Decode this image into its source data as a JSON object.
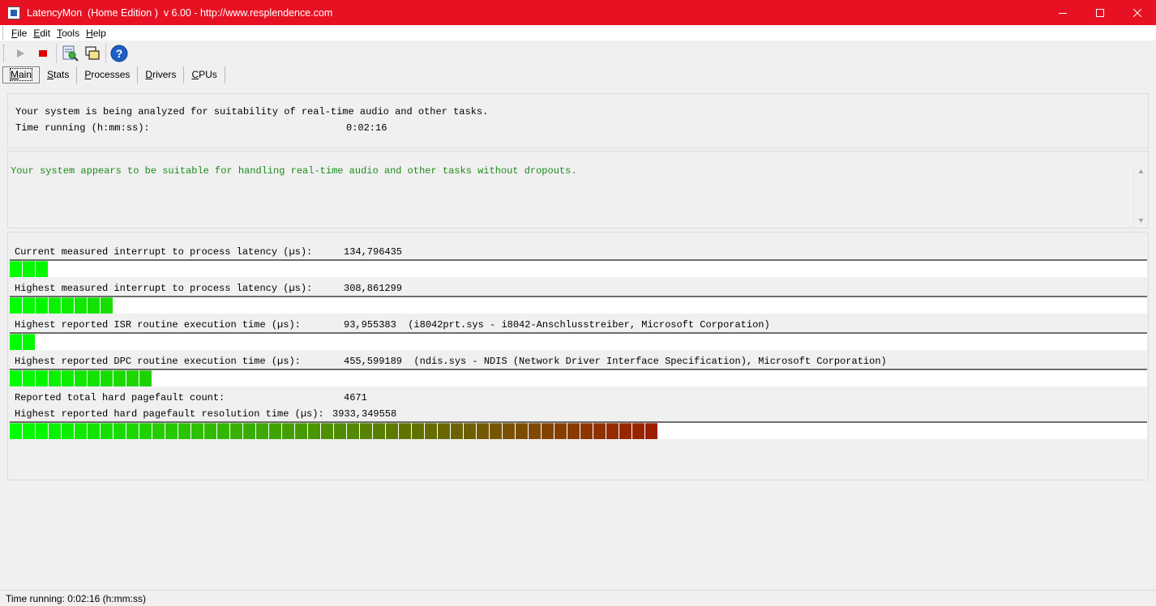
{
  "window": {
    "title": "LatencyMon  (Home Edition )  v 6.00 - http://www.resplendence.com",
    "accent_color": "#e81123"
  },
  "menu": [
    "File",
    "Edit",
    "Tools",
    "Help"
  ],
  "toolbar": {
    "icons": [
      "play-icon",
      "stop-icon",
      "report-icon",
      "windows-icon",
      "help-icon"
    ]
  },
  "tabs": [
    "Main",
    "Stats",
    "Processes",
    "Drivers",
    "CPUs"
  ],
  "summary": {
    "analyzing_text": "Your system is being analyzed for suitability of real-time audio and other tasks.",
    "time_label": "Time running (h:mm:ss):",
    "time_value": "0:02:16"
  },
  "verdict": {
    "text": "Your system appears to be suitable for handling real-time audio and other tasks without dropouts.",
    "color": "#1a8c1a"
  },
  "metrics": [
    {
      "label": "Current measured interrupt to process latency (µs):",
      "value": "134,796435",
      "detail": "",
      "bar_segments": 3
    },
    {
      "label": "Highest measured interrupt to process latency (µs):",
      "value": "308,861299",
      "detail": "",
      "bar_segments": 8
    },
    {
      "label": "Highest reported ISR routine execution time (µs):",
      "value": "93,955383",
      "detail": "(i8042prt.sys - i8042-Anschlusstreiber, Microsoft Corporation)",
      "bar_segments": 2
    },
    {
      "label": "Highest reported DPC routine execution time (µs):",
      "value": "455,599189",
      "detail": "(ndis.sys - NDIS (Network Driver Interface Specification), Microsoft Corporation)",
      "bar_segments": 11
    },
    {
      "label": "Reported total hard pagefault count:",
      "value": "4671",
      "detail": ""
    },
    {
      "label": "Highest reported hard pagefault resolution time (µs):",
      "value": "3933,349558",
      "detail": "",
      "bar_segments": 50
    }
  ],
  "statusbar": {
    "text": "Time running: 0:02:16  (h:mm:ss)"
  }
}
